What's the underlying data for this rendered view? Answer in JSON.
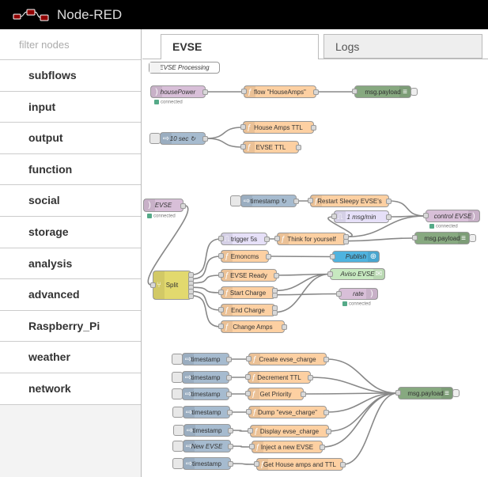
{
  "header": {
    "title": "Node-RED",
    "logo_icon": "node-red-logo"
  },
  "sidebar": {
    "filter_placeholder": "filter nodes",
    "categories": [
      "subflows",
      "input",
      "output",
      "function",
      "social",
      "storage",
      "analysis",
      "advanced",
      "Raspberry_Pi",
      "weather",
      "network"
    ]
  },
  "tabs": [
    {
      "label": "EVSE",
      "active": true
    },
    {
      "label": "Logs",
      "active": false
    }
  ],
  "colors": {
    "function": "#fdd0a2",
    "inject": "#a6bbcf",
    "mqtt": "#d8bfd8",
    "debug": "#87a980",
    "trigger": "#e6e0f8",
    "split": "#e2d96e",
    "email": "#c7e9c0",
    "emoncms": "#4fb3df",
    "comment": "#ffffff"
  },
  "nodes": [
    {
      "id": "c1",
      "type": "comment",
      "label": "EVSE Processing"
    },
    {
      "id": "hp",
      "type": "mqtt",
      "label": "housePower",
      "status": "connected"
    },
    {
      "id": "fha",
      "type": "function",
      "label": "flow \"HouseAmps\""
    },
    {
      "id": "d1",
      "type": "debug",
      "label": "msg.payload"
    },
    {
      "id": "i10",
      "type": "inject",
      "label": "10 sec ↻"
    },
    {
      "id": "fttl",
      "type": "function",
      "label": "House Amps TTL"
    },
    {
      "id": "fettl",
      "type": "function",
      "label": "EVSE TTL"
    },
    {
      "id": "evse",
      "type": "mqtt",
      "label": "EVSE",
      "status": "connected"
    },
    {
      "id": "its",
      "type": "inject",
      "label": "timestamp ↻"
    },
    {
      "id": "frs",
      "type": "function",
      "label": "Restart Sleepy EVSE's"
    },
    {
      "id": "dly",
      "type": "trigger",
      "label": "1 msg/min"
    },
    {
      "id": "ctl",
      "type": "mqtt",
      "label": "control EVSE",
      "status": "connected"
    },
    {
      "id": "trg",
      "type": "trigger",
      "label": "trigger 5s"
    },
    {
      "id": "fth",
      "type": "function",
      "label": "Think for yourself"
    },
    {
      "id": "d2",
      "type": "debug",
      "label": "msg.payload"
    },
    {
      "id": "femc",
      "type": "function",
      "label": "Emoncms"
    },
    {
      "id": "pub",
      "type": "emoncms",
      "label": "Publish"
    },
    {
      "id": "spl",
      "type": "split",
      "label": "Split"
    },
    {
      "id": "frdy",
      "type": "function",
      "label": "EVSE Ready"
    },
    {
      "id": "avs",
      "type": "email",
      "label": "Aviso EVSE"
    },
    {
      "id": "fst",
      "type": "function",
      "label": "Start Charge"
    },
    {
      "id": "rate",
      "type": "mqtt",
      "label": "rate",
      "status": "connected"
    },
    {
      "id": "fend",
      "type": "function",
      "label": "End Charge"
    },
    {
      "id": "fca",
      "type": "function",
      "label": "Change Amps"
    },
    {
      "id": "t1",
      "type": "inject",
      "label": "timestamp"
    },
    {
      "id": "f1",
      "type": "function",
      "label": "Create evse_charge"
    },
    {
      "id": "t2",
      "type": "inject",
      "label": "timestamp"
    },
    {
      "id": "f2",
      "type": "function",
      "label": "Decrement TTL"
    },
    {
      "id": "t3",
      "type": "inject",
      "label": "timestamp"
    },
    {
      "id": "f3",
      "type": "function",
      "label": "Get Priority"
    },
    {
      "id": "t4",
      "type": "inject",
      "label": "timestamp"
    },
    {
      "id": "f4",
      "type": "function",
      "label": "Dump \"evse_charge\""
    },
    {
      "id": "t5",
      "type": "inject",
      "label": "timestamp"
    },
    {
      "id": "f5",
      "type": "function",
      "label": "Display evse_charge"
    },
    {
      "id": "t6",
      "type": "inject",
      "label": "New EVSE"
    },
    {
      "id": "f6",
      "type": "function",
      "label": "Inject a new EVSE"
    },
    {
      "id": "t7",
      "type": "inject",
      "label": "timestamp"
    },
    {
      "id": "f7",
      "type": "function",
      "label": "Get House amps and TTL"
    },
    {
      "id": "d3",
      "type": "debug",
      "label": "msg.payload"
    }
  ]
}
